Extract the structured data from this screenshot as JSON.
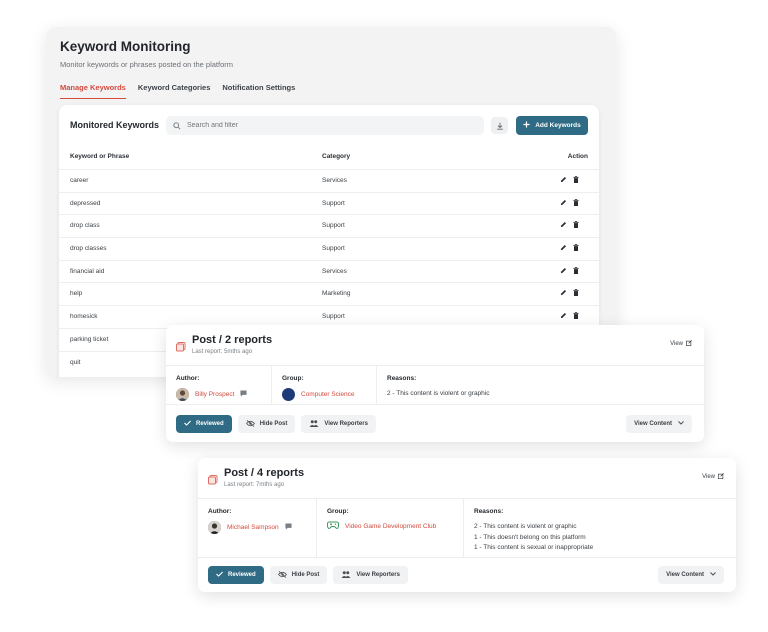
{
  "header": {
    "title": "Keyword Monitoring",
    "subtitle": "Monitor keywords or phrases posted on the platform"
  },
  "tabs": [
    {
      "label": "Manage Keywords",
      "active": true
    },
    {
      "label": "Keyword Categories",
      "active": false
    },
    {
      "label": "Notification Settings",
      "active": false
    }
  ],
  "keywords_card": {
    "title": "Monitored Keywords",
    "search_placeholder": "Search and filter",
    "add_button": "Add Keywords",
    "columns": {
      "keyword": "Keyword or Phrase",
      "category": "Category",
      "action": "Action"
    },
    "rows": [
      {
        "keyword": "career",
        "category": "Services"
      },
      {
        "keyword": "depressed",
        "category": "Support"
      },
      {
        "keyword": "drop class",
        "category": "Support"
      },
      {
        "keyword": "drop classes",
        "category": "Support"
      },
      {
        "keyword": "financial aid",
        "category": "Services"
      },
      {
        "keyword": "help",
        "category": "Marketing"
      },
      {
        "keyword": "homesick",
        "category": "Support"
      },
      {
        "keyword": "parking ticket",
        "category": ""
      },
      {
        "keyword": "quit",
        "category": ""
      }
    ]
  },
  "reports": [
    {
      "title": "Post / 2 reports",
      "last_report": "Last report: 5mths ago",
      "view_label": "View",
      "author_label": "Author:",
      "author": "Billy Prospect",
      "group_label": "Group:",
      "group": "Computer Science",
      "reasons_label": "Reasons:",
      "reasons": [
        "2 - This content is violent or graphic"
      ],
      "reviewed_label": "Reviewed",
      "hide_label": "Hide Post",
      "reporters_label": "View Reporters",
      "view_content_label": "View Content"
    },
    {
      "title": "Post / 4 reports",
      "last_report": "Last report: 7mths ago",
      "view_label": "View",
      "author_label": "Author:",
      "author": "Michael Sampson",
      "group_label": "Group:",
      "group": "Video Game Development Club",
      "reasons_label": "Reasons:",
      "reasons": [
        "2 - This content is violent or graphic",
        "1 - This doesn't belong on this platform",
        "1 - This content is sexual or inappropriate"
      ],
      "reviewed_label": "Reviewed",
      "hide_label": "Hide Post",
      "reporters_label": "View Reporters",
      "view_content_label": "View Content"
    }
  ],
  "colors": {
    "accent": "#d24b3e",
    "primary": "#2f6b84"
  }
}
